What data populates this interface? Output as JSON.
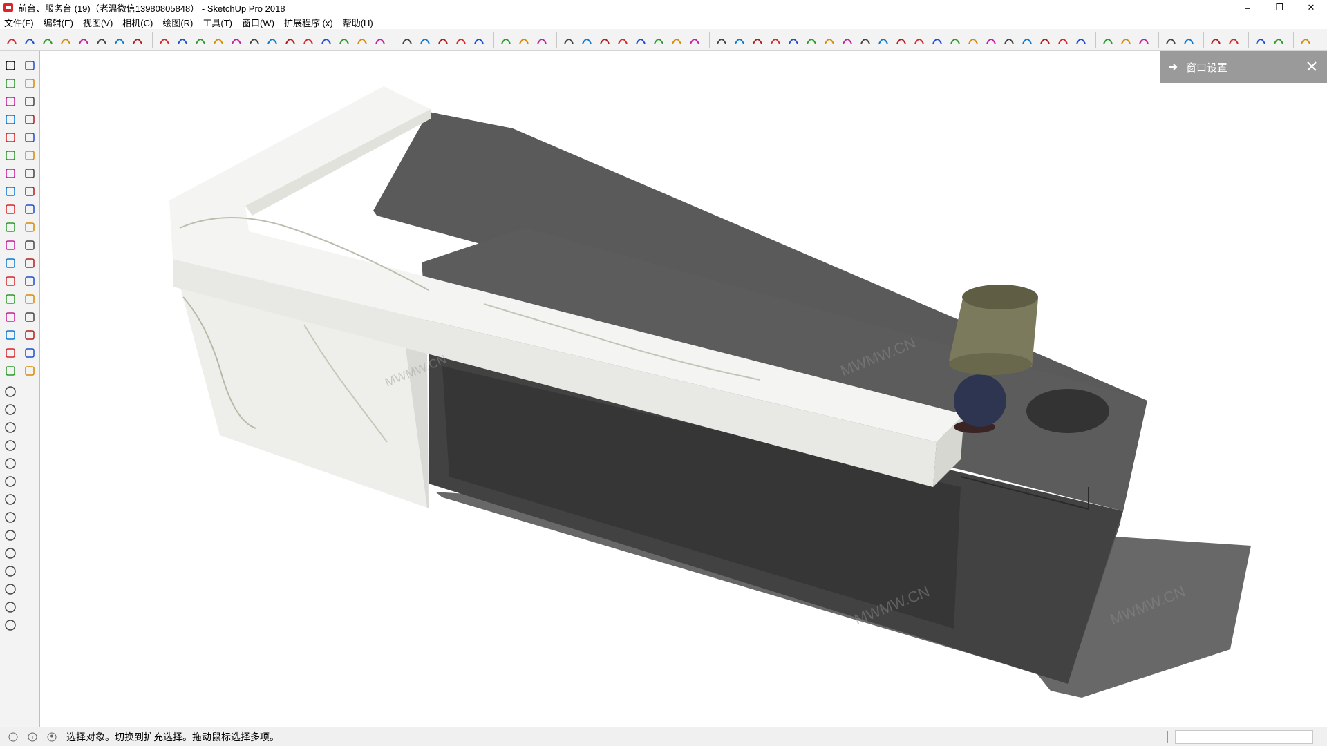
{
  "window": {
    "title": "前台、服务台 (19)（老温微信13980805848） - SketchUp Pro 2018",
    "minimize": "–",
    "restore": "❐",
    "close": "✕"
  },
  "menu": {
    "items": [
      "文件(F)",
      "编辑(E)",
      "视图(V)",
      "相机(C)",
      "绘图(R)",
      "工具(T)",
      "窗口(W)",
      "扩展程序 (x)",
      "帮助(H)"
    ]
  },
  "toolbar": {
    "icons": [
      "select-components-icon",
      "arc-red-icon",
      "circle-black-icon",
      "rainbow-arc-icon",
      "curve-pink-icon",
      "wave-pink-icon",
      "stack-lines-icon",
      "swirl-icon",
      "bezier-icon",
      "wave-icon",
      "zigzag-icon",
      "n-curve-icon",
      "i-curve-icon",
      "arc-small-icon",
      "rectangle-icon",
      "spiral-icon",
      "arc-open-icon",
      "check-curve-icon",
      "bracket-icon",
      "arc-up-icon",
      "arc-red-small-icon",
      "n-shape-icon",
      "octagon-icon",
      "tool-green-icon",
      "circle-pink-icon",
      "tag-pink-icon",
      "shield-icon",
      "house-icon",
      "tree-icon",
      "red-cross-icon",
      "push-down-icon",
      "push-down-blue-icon",
      "push-down-red-icon",
      "push-down-green-icon",
      "push-down-orange-icon",
      "push-down-orange2-icon",
      "push-down-pink-icon",
      "text-3d-icon",
      "triangle-red-icon",
      "cube-shaded-icon",
      "fill-icon",
      "box-multicolor-icon",
      "arrows-up-icon",
      "arrow-down-red-icon",
      "line-red-icon",
      "pencil-icon",
      "compass-icon",
      "panel-icon",
      "book-icon",
      "arrow-right-icon",
      "star-gold-icon",
      "line-blue-icon",
      "list-icon",
      "cubes-yellow-icon",
      "copy-icon",
      "wave-blue-icon",
      "barrel-icon",
      "magic-icon",
      "fullscreen-icon",
      "layout-icon",
      "settings-icon",
      "cube-color-icon",
      "blue-bar-icon",
      "arrows-blue-icon",
      "arrows-red-icon",
      "pen-blue-icon",
      "cross-green-icon",
      "package-icon"
    ]
  },
  "left_tools": {
    "tool_names": [
      "select-tool",
      "eraser-tool",
      "paint-bucket-tool",
      "eraser-red-tool",
      "line-tool",
      "freehand-tool",
      "rectangle-tool",
      "rotated-rectangle-tool",
      "circle-tool",
      "polygon-tool",
      "arc-tool",
      "pie-tool",
      "two-point-arc-tool",
      "three-point-arc-tool",
      "move-tool",
      "push-pull-tool",
      "rotate-tool",
      "follow-me-tool",
      "scale-tool",
      "offset-tool",
      "tape-measure-tool",
      "dimension-tool",
      "protractor-tool",
      "text-tool",
      "axes-tool",
      "3d-text-tool",
      "orbit-tool",
      "pan-tool",
      "zoom-tool",
      "zoom-window-tool",
      "zoom-extents-tool",
      "previous-view-tool",
      "position-camera-tool",
      "look-around-tool",
      "walk-tool",
      "section-plane-tool"
    ],
    "extra_tools": [
      "sandbox-icon",
      "sandbox-2-icon",
      "sandbox-3-icon",
      "sandbox-4-icon",
      "sun-icon",
      "terrain-icon",
      "globe-icon",
      "gear-small-icon",
      "vray-icon",
      "hand-cursor-icon",
      "hand-open-icon",
      "window-icon",
      "window-2-icon",
      "lock-icon"
    ]
  },
  "tray": {
    "title": "窗口设置"
  },
  "status": {
    "message": "选择对象。切换到扩充选择。拖动鼠标选择多项。"
  },
  "watermarks": [
    "MWMW.CN",
    "MWMW.CN",
    "MWMW.CN",
    "MWMW.CN"
  ],
  "colors": {
    "viewport_bg": "#ffffff",
    "tray_bg": "#9a9a9a",
    "counter_dark": "#3c3c3c",
    "shadow": "#656565",
    "marble": "#f2f2f0",
    "lamp_shade": "#7b7a5c",
    "lamp_base": "#2e3550"
  }
}
